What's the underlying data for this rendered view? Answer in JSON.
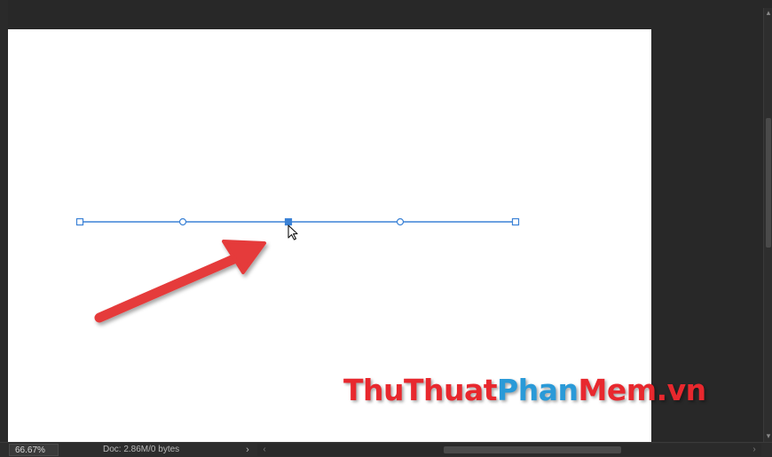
{
  "statusbar": {
    "zoom": "66.67%",
    "doc_info": "Doc: 2.86M/0 bytes",
    "doc_arrow_icon": "chevron-right-icon",
    "hscroll_left_icon": "chevron-left-icon",
    "hscroll_right_icon": "chevron-right-icon"
  },
  "scrollbar": {
    "up_icon": "chevron-up-icon",
    "down_icon": "chevron-down-icon"
  },
  "canvas": {
    "path": {
      "color": "#3b82d6",
      "anchor_count": 5
    },
    "arrow_color": "#e53a3a",
    "cursor_icon": "direct-select-arrow-icon"
  },
  "watermark": {
    "part1": "ThuThuat",
    "part2": "Phan",
    "part3": "Mem.vn"
  },
  "colors": {
    "pasteboard": "#282828",
    "document": "#ffffff",
    "path_blue": "#3b82d6",
    "arrow_red": "#e53a3a"
  }
}
